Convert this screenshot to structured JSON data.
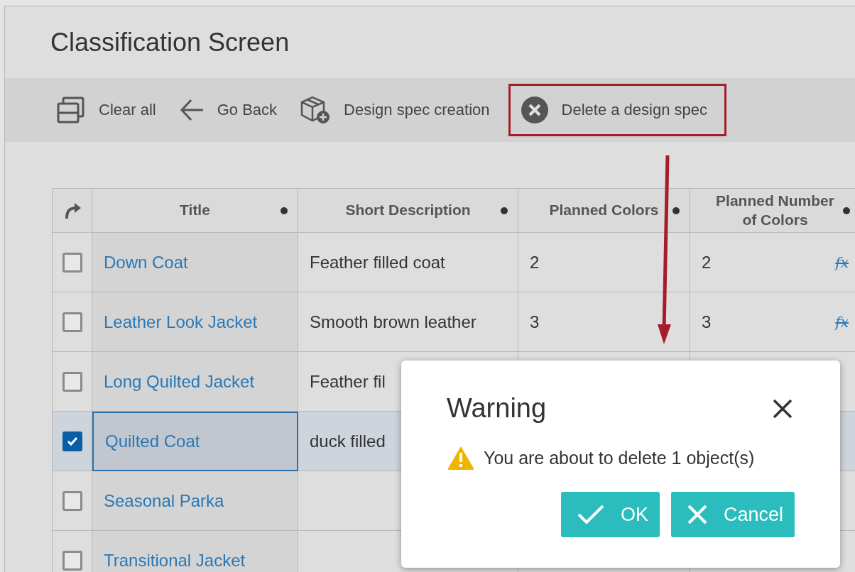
{
  "page": {
    "title": "Classification Screen"
  },
  "toolbar": [
    {
      "kind": "clear",
      "label": "Clear all",
      "highlighted": false
    },
    {
      "kind": "back",
      "label": "Go Back",
      "highlighted": false
    },
    {
      "kind": "create",
      "label": "Design spec creation",
      "highlighted": false
    },
    {
      "kind": "delete",
      "label": "Delete a design spec",
      "highlighted": true
    }
  ],
  "table": {
    "columns": [
      {
        "label": "Title"
      },
      {
        "label": "Short Description"
      },
      {
        "label": "Planned Colors"
      },
      {
        "label": "Planned Number of Colors"
      }
    ],
    "rows": [
      {
        "checked": false,
        "selected": false,
        "title": "Down Coat",
        "short_description": "Feather filled coat",
        "planned_colors": "2",
        "planned_number_of_colors": "2",
        "formula": "fx"
      },
      {
        "checked": false,
        "selected": false,
        "title": "Leather Look Jacket",
        "short_description": "Smooth brown leather",
        "planned_colors": "3",
        "planned_number_of_colors": "3",
        "formula": "fx"
      },
      {
        "checked": false,
        "selected": false,
        "title": "Long Quilted Jacket",
        "short_description": "Feather fil"
      },
      {
        "checked": true,
        "selected": true,
        "title": "Quilted Coat",
        "short_description": "duck filled"
      },
      {
        "checked": false,
        "selected": false,
        "title": "Seasonal Parka"
      },
      {
        "checked": false,
        "selected": false,
        "title": "Transitional Jacket"
      }
    ]
  },
  "dialog": {
    "title": "Warning",
    "message": "You are about to delete 1 object(s)",
    "buttons": [
      {
        "kind": "ok",
        "label": "OK"
      },
      {
        "kind": "cancel",
        "label": "Cancel"
      }
    ]
  }
}
